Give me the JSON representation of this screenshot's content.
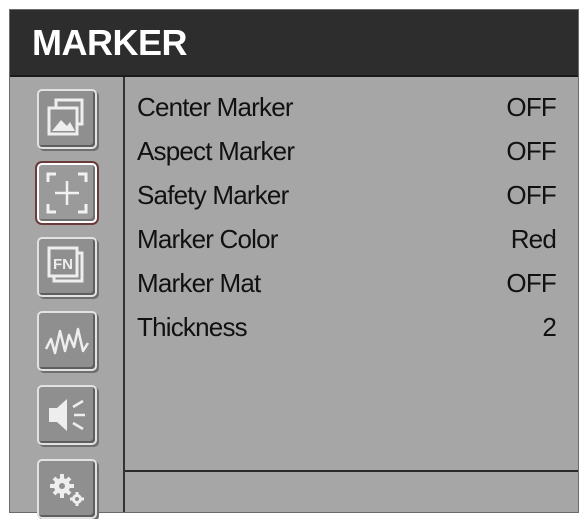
{
  "header": {
    "title": "MARKER"
  },
  "sidebar": {
    "items": [
      {
        "icon": "picture-icon",
        "active": false
      },
      {
        "icon": "marker-crosshair-icon",
        "active": true
      },
      {
        "icon": "function-key-icon",
        "active": false
      },
      {
        "icon": "waveform-icon",
        "active": false
      },
      {
        "icon": "speaker-icon",
        "active": false
      },
      {
        "icon": "gears-icon",
        "active": false
      }
    ]
  },
  "menu": {
    "items": [
      {
        "label": "Center Marker",
        "value": "OFF"
      },
      {
        "label": "Aspect Marker",
        "value": "OFF"
      },
      {
        "label": "Safety Marker",
        "value": "OFF"
      },
      {
        "label": "Marker Color",
        "value": "Red"
      },
      {
        "label": "Marker Mat",
        "value": "OFF"
      },
      {
        "label": "Thickness",
        "value": "2"
      }
    ]
  },
  "colors": {
    "header_bg": "#2d2d2d",
    "panel_bg": "#a6a6a6",
    "active_outline": "#6b3a3a"
  }
}
